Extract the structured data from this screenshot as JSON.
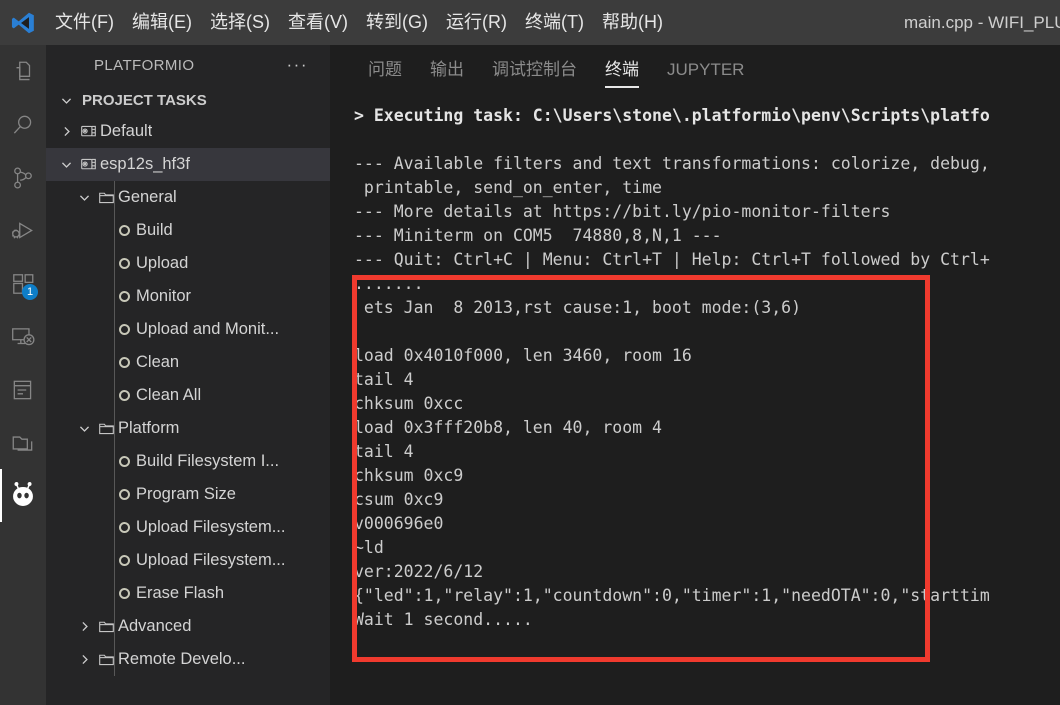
{
  "titlebar": {
    "logo_icon": "vscode-logo-icon",
    "window_title": "main.cpp - WIFI_PLU",
    "menus": [
      {
        "label": "文件(F)",
        "name": "menu-file"
      },
      {
        "label": "编辑(E)",
        "name": "menu-edit"
      },
      {
        "label": "选择(S)",
        "name": "menu-selection"
      },
      {
        "label": "查看(V)",
        "name": "menu-view"
      },
      {
        "label": "转到(G)",
        "name": "menu-goto"
      },
      {
        "label": "运行(R)",
        "name": "menu-run"
      },
      {
        "label": "终端(T)",
        "name": "menu-terminal"
      },
      {
        "label": "帮助(H)",
        "name": "menu-help"
      }
    ]
  },
  "activitybar": {
    "items": [
      {
        "icon": "explorer-icon",
        "active": false,
        "badge": null
      },
      {
        "icon": "search-icon",
        "active": false,
        "badge": null
      },
      {
        "icon": "source-control-icon",
        "active": false,
        "badge": null
      },
      {
        "icon": "run-and-debug-icon",
        "active": false,
        "badge": null
      },
      {
        "icon": "extensions-icon",
        "active": false,
        "badge": "1"
      },
      {
        "icon": "remote-explorer-icon",
        "active": false,
        "badge": null
      },
      {
        "icon": "notebook-icon",
        "active": false,
        "badge": null
      },
      {
        "icon": "folder-icon",
        "active": false,
        "badge": null
      },
      {
        "icon": "platformio-alien-icon",
        "active": true,
        "badge": null
      }
    ]
  },
  "sidebar": {
    "title": "PLATFORMIO",
    "more_actions_label": "···",
    "section_title": "PROJECT TASKS",
    "tree": [
      {
        "label": "Default",
        "indent": 1,
        "icon": "board-icon",
        "twisty": "collapsed",
        "selected": false
      },
      {
        "label": "esp12s_hf3f",
        "indent": 1,
        "icon": "board-icon",
        "twisty": "expanded",
        "selected": true
      },
      {
        "label": "General",
        "indent": 2,
        "icon": "folder-icon",
        "twisty": "expanded",
        "selected": false
      },
      {
        "label": "Build",
        "indent": 3,
        "icon": "task-icon",
        "twisty": "none",
        "selected": false
      },
      {
        "label": "Upload",
        "indent": 3,
        "icon": "task-icon",
        "twisty": "none",
        "selected": false
      },
      {
        "label": "Monitor",
        "indent": 3,
        "icon": "task-icon",
        "twisty": "none",
        "selected": false
      },
      {
        "label": "Upload and Monit...",
        "indent": 3,
        "icon": "task-icon",
        "twisty": "none",
        "selected": false
      },
      {
        "label": "Clean",
        "indent": 3,
        "icon": "task-icon",
        "twisty": "none",
        "selected": false
      },
      {
        "label": "Clean All",
        "indent": 3,
        "icon": "task-icon",
        "twisty": "none",
        "selected": false
      },
      {
        "label": "Platform",
        "indent": 2,
        "icon": "folder-icon",
        "twisty": "expanded",
        "selected": false
      },
      {
        "label": "Build Filesystem I...",
        "indent": 3,
        "icon": "task-icon",
        "twisty": "none",
        "selected": false
      },
      {
        "label": "Program Size",
        "indent": 3,
        "icon": "task-icon",
        "twisty": "none",
        "selected": false
      },
      {
        "label": "Upload Filesystem...",
        "indent": 3,
        "icon": "task-icon",
        "twisty": "none",
        "selected": false
      },
      {
        "label": "Upload Filesystem...",
        "indent": 3,
        "icon": "task-icon",
        "twisty": "none",
        "selected": false
      },
      {
        "label": "Erase Flash",
        "indent": 3,
        "icon": "task-icon",
        "twisty": "none",
        "selected": false
      },
      {
        "label": "Advanced",
        "indent": 2,
        "icon": "folder-icon",
        "twisty": "collapsed",
        "selected": false
      },
      {
        "label": "Remote Develo...",
        "indent": 2,
        "icon": "folder-icon",
        "twisty": "collapsed",
        "selected": false
      }
    ]
  },
  "panel": {
    "tabs": [
      {
        "label": "问题",
        "name": "tab-problems",
        "active": false
      },
      {
        "label": "输出",
        "name": "tab-output",
        "active": false
      },
      {
        "label": "调试控制台",
        "name": "tab-debug-console",
        "active": false
      },
      {
        "label": "终端",
        "name": "tab-terminal",
        "active": true
      },
      {
        "label": "JUPYTER",
        "name": "tab-jupyter",
        "active": false
      }
    ],
    "terminal_lines": [
      {
        "text": "> Executing task: C:\\Users\\stone\\.platformio\\penv\\Scripts\\platfo",
        "bold": true
      },
      {
        "text": "",
        "bold": false
      },
      {
        "text": "--- Available filters and text transformations: colorize, debug,",
        "bold": false
      },
      {
        "text": " printable, send_on_enter, time",
        "bold": false
      },
      {
        "text": "--- More details at https://bit.ly/pio-monitor-filters",
        "bold": false
      },
      {
        "text": "--- Miniterm on COM5  74880,8,N,1 ---",
        "bold": false
      },
      {
        "text": "--- Quit: Ctrl+C | Menu: Ctrl+T | Help: Ctrl+T followed by Ctrl+",
        "bold": false
      },
      {
        "text": ".......",
        "bold": false
      },
      {
        "text": " ets Jan  8 2013,rst cause:1, boot mode:(3,6)",
        "bold": false
      },
      {
        "text": "",
        "bold": false
      },
      {
        "text": "load 0x4010f000, len 3460, room 16",
        "bold": false
      },
      {
        "text": "tail 4",
        "bold": false
      },
      {
        "text": "chksum 0xcc",
        "bold": false
      },
      {
        "text": "load 0x3fff20b8, len 40, room 4",
        "bold": false
      },
      {
        "text": "tail 4",
        "bold": false
      },
      {
        "text": "chksum 0xc9",
        "bold": false
      },
      {
        "text": "csum 0xc9",
        "bold": false
      },
      {
        "text": "v000696e0",
        "bold": false
      },
      {
        "text": "~ld",
        "bold": false
      },
      {
        "text": "ver:2022/6/12",
        "bold": false
      },
      {
        "text": "{\"led\":1,\"relay\":1,\"countdown\":0,\"timer\":1,\"needOTA\":0,\"starttim",
        "bold": false
      },
      {
        "text": "Wait 1 second.....",
        "bold": false
      }
    ],
    "highlight_box": {
      "name": "red-annotation-box",
      "color": "#f03a2e"
    }
  }
}
